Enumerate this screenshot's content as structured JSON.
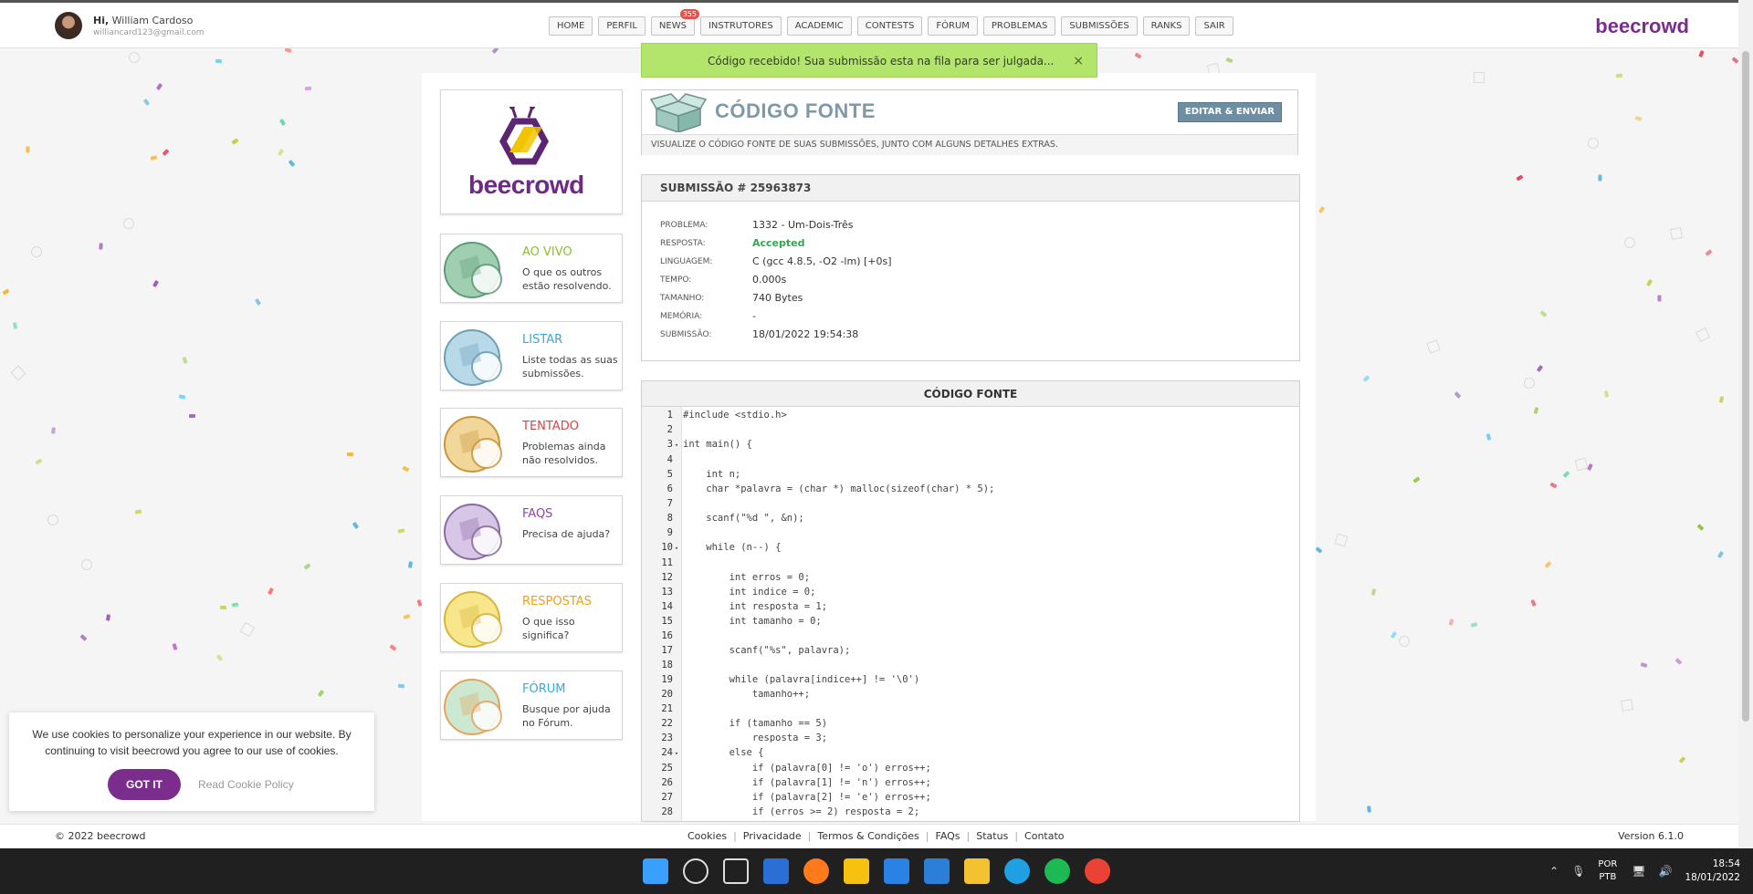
{
  "header": {
    "greeting_hi": "Hi,",
    "user_name": "William Cardoso",
    "email": "williancard123@gmail.com",
    "brand": "beecrowd",
    "nav": [
      {
        "label": "HOME"
      },
      {
        "label": "PERFIL"
      },
      {
        "label": "NEWS",
        "badge": "355"
      },
      {
        "label": "INSTRUTORES"
      },
      {
        "label": "ACADEMIC"
      },
      {
        "label": "CONTESTS"
      },
      {
        "label": "FÓRUM"
      },
      {
        "label": "PROBLEMAS"
      },
      {
        "label": "SUBMISSÕES"
      },
      {
        "label": "RANKS"
      },
      {
        "label": "SAIR"
      }
    ]
  },
  "toast": {
    "message": "Código recebido! Sua submissão esta na fila para ser julgada...",
    "close": "×"
  },
  "logo": {
    "text": "beecrowd"
  },
  "sidebar": [
    {
      "title": "AO VIVO",
      "desc": "O que os outros estão resolvendo.",
      "color": "#8dbf2f"
    },
    {
      "title": "LISTAR",
      "desc": "Liste todas as suas submissões.",
      "color": "#36a9d6"
    },
    {
      "title": "TENTADO",
      "desc": "Problemas ainda não resolvidos.",
      "color": "#e2403f"
    },
    {
      "title": "FAQS",
      "desc": "Precisa de ajuda?",
      "color": "#8e44ad"
    },
    {
      "title": "RESPOSTAS",
      "desc": "O que isso significa?",
      "color": "#f0a011"
    },
    {
      "title": "FÓRUM",
      "desc": "Busque por ajuda no Fórum.",
      "color": "#36a9d6"
    }
  ],
  "page_header": {
    "title": "CÓDIGO FONTE",
    "button": "EDITAR & ENVIAR",
    "subtitle": "VISUALIZE O CÓDIGO FONTE DE SUAS SUBMISSÕES, JUNTO COM ALGUNS DETALHES EXTRAS."
  },
  "submission": {
    "heading": "SUBMISSÃO # 25963873",
    "rows": [
      {
        "key": "PROBLEMA:",
        "value": "1332 - Um-Dois-Três"
      },
      {
        "key": "RESPOSTA:",
        "value": "Accepted"
      },
      {
        "key": "LINGUAGEM:",
        "value": "C (gcc 4.8.5, -O2 -lm) [+0s]"
      },
      {
        "key": "TEMPO:",
        "value": "0.000s"
      },
      {
        "key": "TAMANHO:",
        "value": "740 Bytes"
      },
      {
        "key": "MEMÓRIA:",
        "value": "-"
      },
      {
        "key": "SUBMISSÃO:",
        "value": "18/01/2022 19:54:38"
      }
    ]
  },
  "code": {
    "heading": "CÓDIGO FONTE",
    "lines": [
      "#include <stdio.h>",
      "",
      "int main() {",
      "",
      "    int n;",
      "    char *palavra = (char *) malloc(sizeof(char) * 5);",
      "",
      "    scanf(\"%d \", &n);",
      "",
      "    while (n--) {",
      "",
      "        int erros = 0;",
      "        int indice = 0;",
      "        int resposta = 1;",
      "        int tamanho = 0;",
      "",
      "        scanf(\"%s\", palavra);",
      "",
      "        while (palavra[indice++] != '\\0')",
      "            tamanho++;",
      "",
      "        if (tamanho == 5)",
      "            resposta = 3;",
      "        else {",
      "            if (palavra[0] != 'o') erros++;",
      "            if (palavra[1] != 'n') erros++;",
      "            if (palavra[2] != 'e') erros++;",
      "            if (erros >= 2) resposta = 2;",
      "        }"
    ],
    "fold_lines": [
      3,
      10,
      24
    ]
  },
  "cookie": {
    "text": "We use cookies to personalize your experience in our website. By continuing to visit beecrowd you agree to our use of cookies.",
    "accept": "GOT IT",
    "policy": "Read Cookie Policy"
  },
  "footer": {
    "copyright": "© 2022 beecrowd",
    "links": [
      "Cookies",
      "Privacidade",
      "Termos & Condições",
      "FAQs",
      "Status",
      "Contato"
    ],
    "version": "Version 6.1.0"
  },
  "taskbar": {
    "lang_top": "POR",
    "lang_bottom": "PTB",
    "time": "18:54",
    "date": "18/01/2022",
    "apps": [
      "windows-start",
      "search",
      "task-view",
      "widgets",
      "firefox",
      "sticky-notes",
      "store",
      "mail",
      "file-explorer",
      "edge",
      "spotify",
      "chrome"
    ]
  },
  "colors": {
    "brand": "#7b2d8e",
    "toast": "#b3e56d",
    "accepted": "#2fa84f",
    "button": "#6e8fa3"
  }
}
